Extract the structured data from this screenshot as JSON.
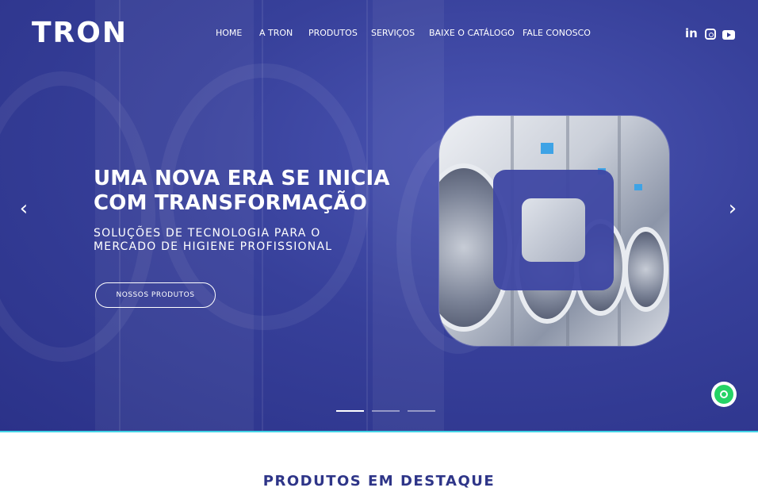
{
  "brand": {
    "logo_text": "TRON"
  },
  "nav": {
    "items": [
      {
        "label": "HOME"
      },
      {
        "label": "A TRON"
      },
      {
        "label": "PRODUTOS"
      },
      {
        "label": "SERVIÇOS"
      },
      {
        "label": "BAIXE O CATÁLOGO"
      },
      {
        "label": "FALE CONOSCO"
      }
    ]
  },
  "social": {
    "icons": [
      "linkedin-icon",
      "instagram-icon",
      "youtube-icon"
    ]
  },
  "hero": {
    "headline_line1": "UMA NOVA ERA SE INICIA",
    "headline_line2": "COM TRANSFORMAÇÃO",
    "subline_line1": "SOLUÇÕES DE TECNOLOGIA PARA O",
    "subline_line2": "MERCADO DE HIGIENE PROFISSIONAL",
    "cta_label": "NOSSOS PRODUTOS",
    "prev_glyph": "‹",
    "next_glyph": "›",
    "slides_count": 3,
    "active_slide": 1
  },
  "featured": {
    "title": "PRODUTOS EM DESTAQUE"
  },
  "colors": {
    "hero_blue": "#2f3790",
    "accent_cyan": "#43d3e6",
    "title_blue": "#2e3588",
    "whatsapp_green": "#25d366"
  }
}
